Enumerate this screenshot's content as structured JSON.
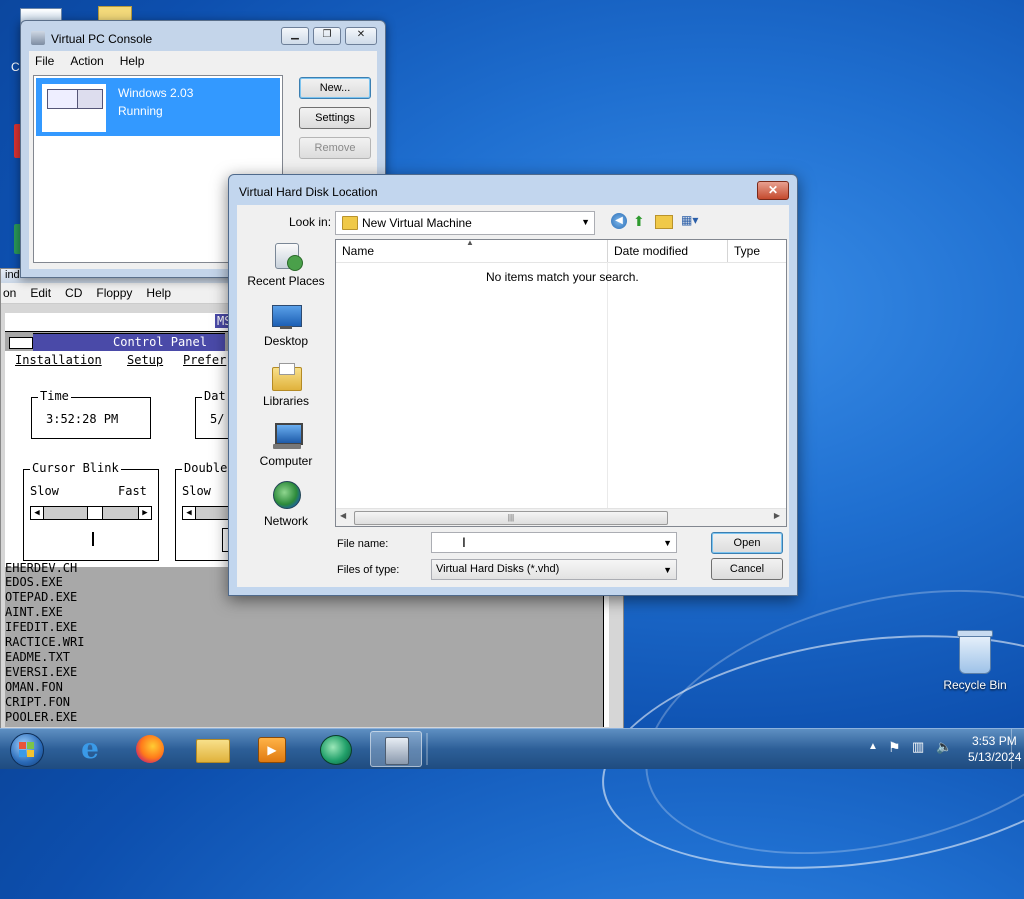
{
  "desktop": {
    "recycle_bin_label": "Recycle Bin",
    "partial_label": "C"
  },
  "vm_window": {
    "title_fragment": "indows 2.03 - Microsoft Virtual PC",
    "menu": [
      "on",
      "Edit",
      "CD",
      "Floppy",
      "Help"
    ],
    "ms_fragment": "MS",
    "control_panel_title": "Control Panel",
    "cp_menu": [
      "Installation",
      "Setup",
      "Prefer"
    ],
    "time_label": "Time",
    "time_value": "3:52:28 PM",
    "date_label": "Dat",
    "date_value": "5/",
    "cursor_blink_label": "Cursor Blink",
    "slow": "Slow",
    "fast": "Fast",
    "double_label": "Double",
    "slow2": "Slow",
    "files": [
      "EHERDEV.CH",
      "EDOS.EXE",
      "OTEPAD.EXE",
      "AINT.EXE",
      "IFEDIT.EXE",
      "RACTICE.WRI",
      "EADME.TXT",
      "EVERSI.EXE",
      "OMAN.FON",
      "CRIPT.FON",
      "POOLER.EXE"
    ]
  },
  "console": {
    "title": "Virtual PC Console",
    "menu": [
      "File",
      "Action",
      "Help"
    ],
    "vm_name": "Windows 2.03",
    "vm_status": "Running",
    "buttons": {
      "new": "New...",
      "settings": "Settings",
      "remove": "Remove"
    }
  },
  "dialog": {
    "title": "Virtual Hard Disk Location",
    "look_in_label": "Look in:",
    "look_in_value": "New Virtual Machine",
    "places": [
      "Recent Places",
      "Desktop",
      "Libraries",
      "Computer",
      "Network"
    ],
    "columns": [
      "Name",
      "Date modified",
      "Type"
    ],
    "empty_message": "No items match your search.",
    "file_name_label": "File name:",
    "file_name_value": "",
    "files_of_type_label": "Files of type:",
    "files_of_type_value": "Virtual Hard Disks (*.vhd)",
    "open_button": "Open",
    "cancel_button": "Cancel"
  },
  "taskbar": {
    "time": "3:53 PM",
    "date": "5/13/2024",
    "pinned": [
      "start-orb",
      "internet-explorer",
      "firefox",
      "windows-explorer",
      "media-player",
      "virtual-pc-globe",
      "virtual-pc-console"
    ]
  },
  "colors": {
    "selection": "#3399ff",
    "win2_titlebar": "#4a4aa8",
    "desktop": "#1f6fd0"
  }
}
